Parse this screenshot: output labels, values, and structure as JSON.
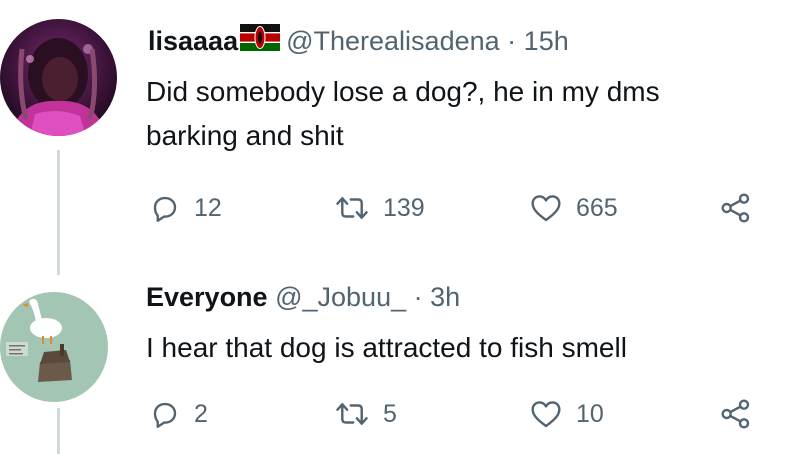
{
  "colors": {
    "text": "#0f1419",
    "muted": "#536471",
    "thread_line": "#cfd9de"
  },
  "tweets": [
    {
      "name": "lisaaaa",
      "flag_icon": "kenya-flag-icon",
      "handle": "@Therealisadena",
      "separator": "·",
      "time": "15h",
      "text_lines": [
        "Did somebody lose a dog?, he in my dms",
        "barking and shit"
      ],
      "replies": "12",
      "retweets": "139",
      "likes": "665"
    },
    {
      "name": "Everyone",
      "handle": "@_Jobuu_",
      "separator": "·",
      "time": "3h",
      "text_lines": [
        "I hear that dog is attracted to fish smell"
      ],
      "replies": "2",
      "retweets": "5",
      "likes": "10"
    }
  ]
}
